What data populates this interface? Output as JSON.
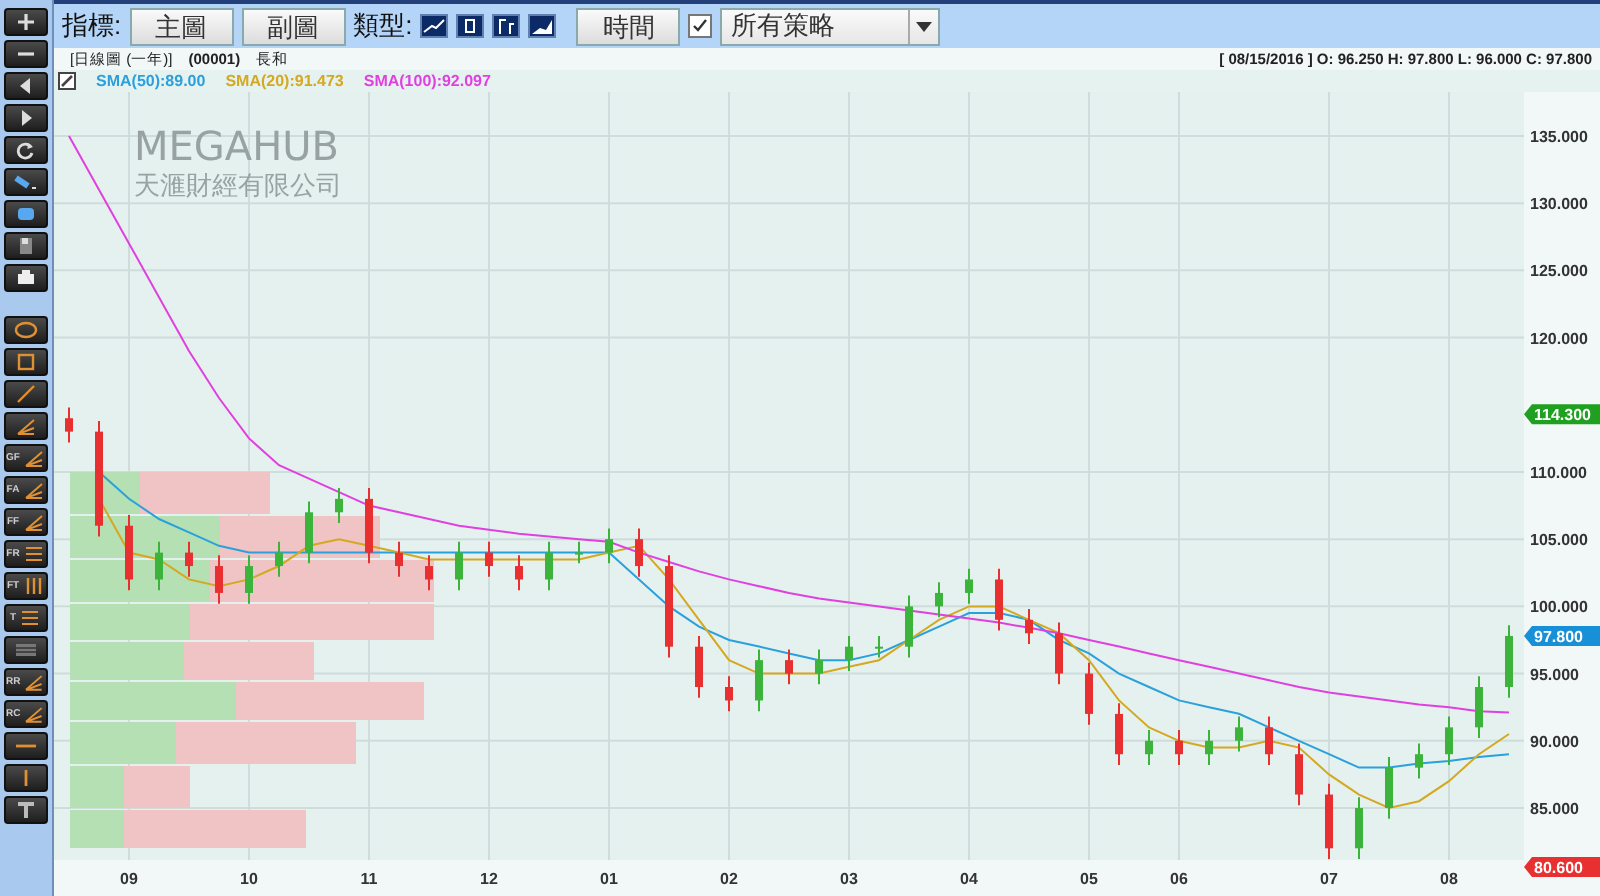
{
  "tools": [
    {
      "kind": "plus"
    },
    {
      "kind": "minus"
    },
    {
      "kind": "left"
    },
    {
      "kind": "right"
    },
    {
      "kind": "refresh"
    },
    {
      "kind": "pen"
    },
    {
      "kind": "eraser"
    },
    {
      "kind": "save"
    },
    {
      "kind": "print"
    },
    {
      "kind": "gap"
    },
    {
      "kind": "ellipse"
    },
    {
      "kind": "rect"
    },
    {
      "kind": "line"
    },
    {
      "kind": "fan"
    },
    {
      "kind": "fan",
      "label": "GF"
    },
    {
      "kind": "fan",
      "label": "FA"
    },
    {
      "kind": "fan",
      "label": "FF"
    },
    {
      "kind": "lines",
      "label": "FR"
    },
    {
      "kind": "bars",
      "label": "FT"
    },
    {
      "kind": "lines",
      "label": "T"
    },
    {
      "kind": "box"
    },
    {
      "kind": "fan",
      "label": "RR"
    },
    {
      "kind": "fan",
      "label": "RC"
    },
    {
      "kind": "hline"
    },
    {
      "kind": "vline"
    },
    {
      "kind": "text"
    }
  ],
  "toolbar": {
    "indicator_label": "指標:",
    "buttons": [
      "主圖",
      "副圖"
    ],
    "type_label": "類型:",
    "chart_types": [
      {
        "kind": "line",
        "selected": false
      },
      {
        "kind": "candle",
        "selected": false
      },
      {
        "kind": "bar",
        "selected": false
      },
      {
        "kind": "area",
        "selected": false
      }
    ],
    "time_button": "時間",
    "strategy_checkbox": {
      "checked": true
    },
    "strategy_dropdown": {
      "value": "所有策略"
    }
  },
  "info": {
    "period": "[日線圖 (一年)]",
    "code": "(00001)",
    "name": "長和",
    "quote": "[ 08/15/2016 ]   O: 96.250   H: 97.800   L: 96.000   C: 97.800"
  },
  "legend_values": [
    ":89.00",
    ":91.473",
    ":92.097"
  ],
  "watermark": {
    "title": "MEGAHUB",
    "subtitle": "天滙財經有限公司"
  },
  "price_tags": [
    {
      "text": "114.300",
      "color": "#20a020"
    },
    {
      "text": "97.800",
      "color": "#1890d8"
    },
    {
      "text": "80.600",
      "color": "#e83030"
    }
  ],
  "chart_data": {
    "type": "candlestick",
    "categories": [
      null,
      null,
      "09",
      null,
      null,
      null,
      "10",
      null,
      null,
      null,
      "11",
      null,
      null,
      null,
      "12",
      null,
      null,
      null,
      "01",
      null,
      null,
      null,
      "02",
      null,
      null,
      null,
      "03",
      null,
      null,
      null,
      "04",
      null,
      null,
      null,
      "05",
      null,
      null,
      "06",
      null,
      null,
      null,
      null,
      "07",
      null,
      null,
      null,
      "08",
      null,
      null
    ],
    "ylim": [
      81.13,
      138.27
    ],
    "grid": true,
    "yticks": [
      {
        "value": 85,
        "label": "85.000"
      },
      {
        "value": 90,
        "label": "90.000"
      },
      {
        "value": 95,
        "label": "95.000"
      },
      {
        "value": 100,
        "label": "100.000"
      },
      {
        "value": 105,
        "label": "105.000"
      },
      {
        "value": 110,
        "label": "110.000"
      },
      {
        "value": 120,
        "label": "120.000"
      },
      {
        "value": 125,
        "label": "125.000"
      },
      {
        "value": 130,
        "label": "130.000"
      },
      {
        "value": 135,
        "label": "135.000"
      }
    ],
    "ohlc": [
      [
        114,
        114.8,
        112.2,
        113
      ],
      [
        113,
        113.8,
        105.2,
        106
      ],
      [
        106,
        106.8,
        101.2,
        102
      ],
      [
        102,
        104.8,
        101.2,
        104
      ],
      [
        104,
        104.8,
        102.2,
        103
      ],
      [
        103,
        103.8,
        100.2,
        101
      ],
      [
        101,
        103.8,
        100.2,
        103
      ],
      [
        103,
        104.8,
        102.2,
        104
      ],
      [
        104,
        107.8,
        103.2,
        107
      ],
      [
        107,
        108.8,
        106.2,
        108
      ],
      [
        108,
        108.8,
        103.2,
        104
      ],
      [
        104,
        104.8,
        102.2,
        103
      ],
      [
        103,
        103.8,
        101.2,
        102
      ],
      [
        102,
        104.8,
        101.2,
        104
      ],
      [
        104,
        104.8,
        102.2,
        103
      ],
      [
        103,
        103.8,
        101.2,
        102
      ],
      [
        102,
        104.8,
        101.2,
        104
      ],
      [
        104,
        104.8,
        103.2,
        104
      ],
      [
        104,
        105.8,
        103.2,
        105
      ],
      [
        105,
        105.8,
        102.2,
        103
      ],
      [
        103,
        103.8,
        96.2,
        97
      ],
      [
        97,
        97.8,
        93.2,
        94
      ],
      [
        94,
        94.8,
        92.2,
        93
      ],
      [
        93,
        96.8,
        92.2,
        96
      ],
      [
        96,
        96.8,
        94.2,
        95
      ],
      [
        95,
        96.8,
        94.2,
        96
      ],
      [
        96,
        97.8,
        95.2,
        97
      ],
      [
        97,
        97.8,
        96.2,
        97
      ],
      [
        97,
        100.8,
        96.2,
        100
      ],
      [
        100,
        101.8,
        99.2,
        101
      ],
      [
        101,
        102.8,
        100.2,
        102
      ],
      [
        102,
        102.8,
        98.2,
        99
      ],
      [
        99,
        99.8,
        97.2,
        98
      ],
      [
        98,
        98.8,
        94.2,
        95
      ],
      [
        95,
        95.8,
        91.2,
        92
      ],
      [
        92,
        92.8,
        88.2,
        89
      ],
      [
        89,
        90.8,
        88.2,
        90
      ],
      [
        90,
        90.8,
        88.2,
        89
      ],
      [
        89,
        90.8,
        88.2,
        90
      ],
      [
        90,
        91.8,
        89.2,
        91
      ],
      [
        91,
        91.8,
        88.2,
        89
      ],
      [
        89,
        89.8,
        85.2,
        86
      ],
      [
        86,
        86.8,
        81.2,
        82
      ],
      [
        82,
        85.8,
        81.2,
        85
      ],
      [
        85,
        88.8,
        84.2,
        88
      ],
      [
        88,
        89.8,
        87.2,
        89
      ],
      [
        89,
        91.8,
        88.2,
        91
      ],
      [
        91,
        94.8,
        90.2,
        94
      ],
      [
        94,
        98.6,
        93.2,
        97.8
      ]
    ],
    "series": [
      {
        "name": "SMA(50)",
        "type": "line",
        "color": "#2aa0dc",
        "values": [
          null,
          110,
          108,
          106.5,
          105.5,
          104.5,
          104,
          104,
          104,
          104,
          104,
          104,
          104,
          104,
          104,
          104,
          104,
          104,
          104,
          102,
          100,
          98.5,
          97.5,
          97,
          96.5,
          96,
          96,
          96.5,
          97.5,
          98.5,
          99.5,
          99.5,
          99,
          97.5,
          96.5,
          95,
          94,
          93,
          92.5,
          92,
          91,
          90,
          89,
          88,
          88,
          88.3,
          88.5,
          88.8,
          89
        ]
      },
      {
        "name": "SMA(20)",
        "type": "line",
        "color": "#d4a820",
        "values": [
          null,
          108,
          104,
          103.5,
          102,
          101.5,
          102,
          103,
          104.5,
          105,
          104.5,
          104,
          103.5,
          103.5,
          103.5,
          103.5,
          103.5,
          103.5,
          104,
          104.5,
          102,
          99,
          96,
          95,
          95,
          95,
          95.5,
          96,
          97.5,
          99,
          100,
          100,
          99,
          98,
          96,
          93,
          91,
          90,
          89.5,
          89.5,
          90,
          89.5,
          87.5,
          86,
          85,
          85.5,
          87,
          89,
          90.5
        ]
      },
      {
        "name": "SMA(100)",
        "type": "line",
        "color": "#e040e0",
        "values": [
          135,
          131,
          127,
          123,
          119,
          115.5,
          112.5,
          110.5,
          109.5,
          108.5,
          107.5,
          107,
          106.5,
          106,
          105.7,
          105.4,
          105.2,
          105,
          104.8,
          104,
          103.3,
          102.6,
          102,
          101.5,
          101,
          100.6,
          100.3,
          100,
          99.7,
          99.4,
          99.1,
          98.8,
          98.4,
          98,
          97.5,
          97,
          96.5,
          96,
          95.5,
          95,
          94.5,
          94,
          93.6,
          93.3,
          93,
          92.7,
          92.5,
          92.2,
          92.1
        ]
      }
    ]
  }
}
